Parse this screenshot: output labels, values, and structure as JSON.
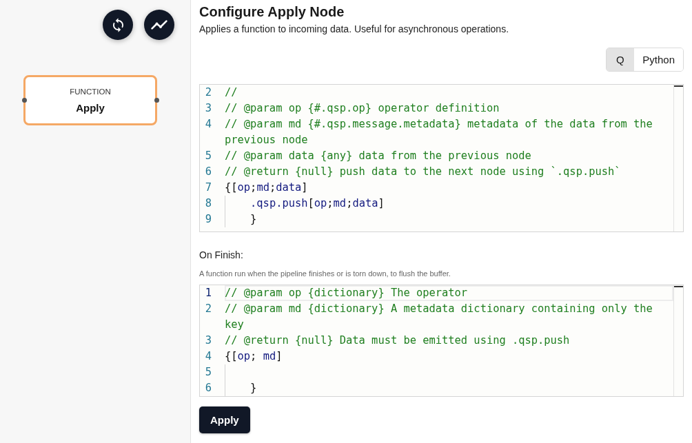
{
  "canvas": {
    "toolbar": [
      {
        "kind": "refresh"
      },
      {
        "kind": "trend"
      }
    ],
    "node": {
      "type_label": "FUNCTION",
      "name": "Apply",
      "selected": true
    }
  },
  "panel": {
    "title": "Configure Apply Node",
    "description": "Applies a function to incoming data. Useful for asynchronous operations.",
    "language_toggle": [
      {
        "label": "Q",
        "selected": true
      },
      {
        "label": "Python",
        "selected": false
      }
    ],
    "editor": {
      "lines": [
        {
          "number": "2",
          "active": false,
          "guide": false,
          "tokens": [
            {
              "kind": "comment",
              "text": "//"
            }
          ]
        },
        {
          "number": "3",
          "active": false,
          "guide": false,
          "tokens": [
            {
              "kind": "comment",
              "text": "// @param op {#.qsp.op} operator definition"
            }
          ]
        },
        {
          "number": "4",
          "active": false,
          "guide": false,
          "tokens": [
            {
              "kind": "comment",
              "text": "// @param md {#.qsp.message.metadata} metadata of the data from the previous node"
            }
          ]
        },
        {
          "number": "5",
          "active": false,
          "guide": false,
          "tokens": [
            {
              "kind": "comment",
              "text": "// @param data {any} data from the previous node"
            }
          ]
        },
        {
          "number": "6",
          "active": false,
          "guide": false,
          "tokens": [
            {
              "kind": "comment",
              "text": "// @return {null} push data to the next node using `.qsp.push`"
            }
          ]
        },
        {
          "number": "7",
          "active": false,
          "guide": false,
          "tokens": [
            {
              "kind": "plain",
              "text": "{["
            },
            {
              "kind": "name",
              "text": "op"
            },
            {
              "kind": "plain",
              "text": ";"
            },
            {
              "kind": "name",
              "text": "md"
            },
            {
              "kind": "plain",
              "text": ";"
            },
            {
              "kind": "name",
              "text": "data"
            },
            {
              "kind": "plain",
              "text": "]"
            }
          ]
        },
        {
          "number": "8",
          "active": false,
          "guide": true,
          "tokens": [
            {
              "kind": "name",
              "text": "    .qsp.push"
            },
            {
              "kind": "plain",
              "text": "["
            },
            {
              "kind": "name",
              "text": "op"
            },
            {
              "kind": "plain",
              "text": ";"
            },
            {
              "kind": "name",
              "text": "md"
            },
            {
              "kind": "plain",
              "text": ";"
            },
            {
              "kind": "name",
              "text": "data"
            },
            {
              "kind": "plain",
              "text": "]"
            }
          ]
        },
        {
          "number": "9",
          "active": false,
          "guide": true,
          "tokens": [
            {
              "kind": "plain",
              "text": "    }"
            }
          ]
        }
      ]
    },
    "on_finish": {
      "label": "On Finish:",
      "hint": "A function run when the pipeline finishes or is torn down, to flush the buffer.",
      "editor": {
        "lines": [
          {
            "number": "1",
            "active": true,
            "guide": false,
            "tokens": [
              {
                "kind": "comment",
                "text": "// @param op {dictionary} The operator"
              }
            ]
          },
          {
            "number": "2",
            "active": false,
            "guide": false,
            "tokens": [
              {
                "kind": "comment",
                "text": "// @param md {dictionary} A metadata dictionary containing only the key"
              }
            ]
          },
          {
            "number": "3",
            "active": false,
            "guide": false,
            "tokens": [
              {
                "kind": "comment",
                "text": "// @return {null} Data must be emitted using .qsp.push"
              }
            ]
          },
          {
            "number": "4",
            "active": false,
            "guide": false,
            "tokens": [
              {
                "kind": "plain",
                "text": "{["
              },
              {
                "kind": "name",
                "text": "op"
              },
              {
                "kind": "plain",
                "text": "; "
              },
              {
                "kind": "name",
                "text": "md"
              },
              {
                "kind": "plain",
                "text": "]"
              }
            ]
          },
          {
            "number": "5",
            "active": false,
            "guide": true
          },
          {
            "number": "6",
            "active": false,
            "guide": true,
            "tokens": [
              {
                "kind": "plain",
                "text": "    }"
              }
            ]
          }
        ]
      }
    },
    "apply_button": "Apply"
  }
}
